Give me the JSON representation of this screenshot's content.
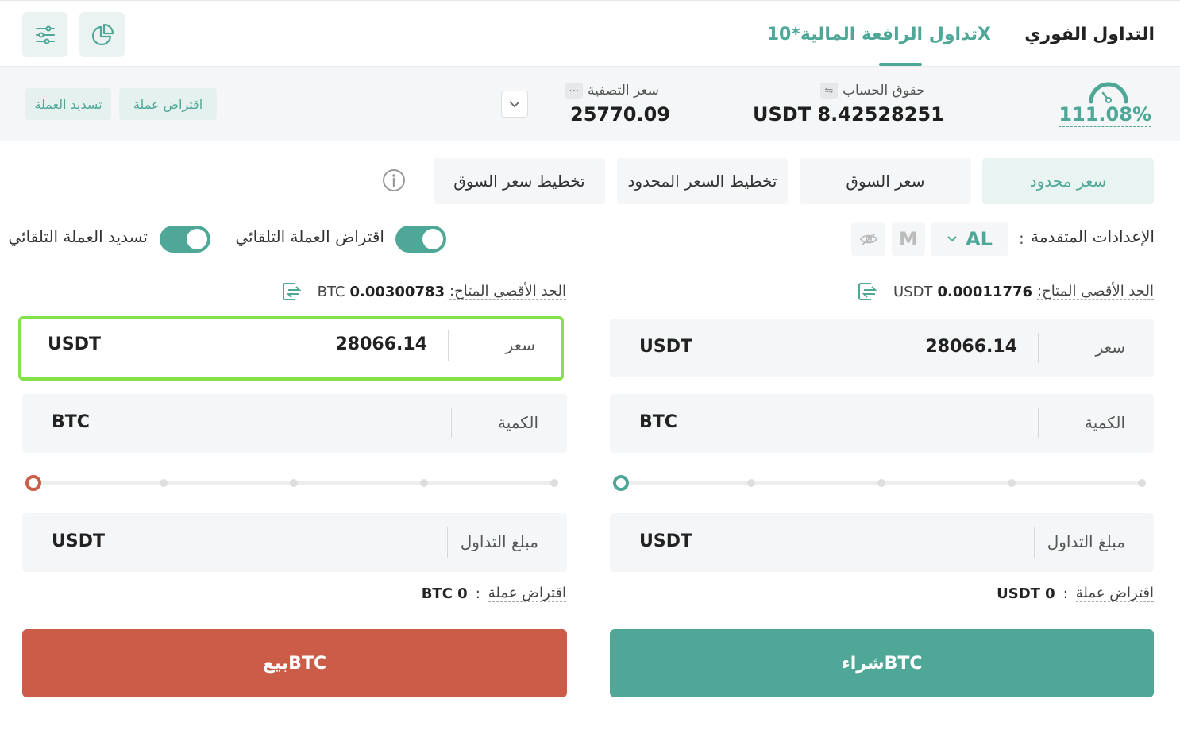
{
  "header": {
    "tab_spot": "التداول الفوري",
    "tab_margin": "تداول الرافعة المالية*10X",
    "filter_icon": "sliders-icon",
    "chart_icon": "pie-chart-icon"
  },
  "account": {
    "risk_ratio": "111.08%",
    "equity_label": "حقوق الحساب",
    "equity_value": "USDT 8.42528251",
    "liq_label": "سعر التصفية",
    "liq_value": "25770.09",
    "borrow_btn": "اقتراض عملة",
    "repay_btn": "تسديد العملة"
  },
  "order_tabs": {
    "limit": "سعر محدود",
    "market": "سعر السوق",
    "plan_limit": "تخطيط السعر المحدود",
    "plan_market": "تخطيط سعر السوق"
  },
  "settings": {
    "advanced_label": "الإعدادات المتقدمة",
    "colon": ":",
    "al": "AL",
    "m": "M",
    "auto_borrow": "اقتراض العملة التلقائي",
    "auto_repay": "تسديد العملة التلقائي"
  },
  "buy": {
    "avail_label": "الحد الأقصى المتاح:",
    "avail_value": "0.00011776",
    "avail_currency": "USDT",
    "price_label": "سعر",
    "price_value": "28066.14",
    "price_unit": "USDT",
    "qty_label": "الكمية",
    "qty_unit": "BTC",
    "amount_label": "مبلغ التداول",
    "amount_unit": "USDT",
    "borrow_label": "اقتراض عملة",
    "borrow_sep": ":",
    "borrow_value": "USDT 0",
    "button": "شراءBTC",
    "color": "#4fa897"
  },
  "sell": {
    "avail_label": "الحد الأقصى المتاح:",
    "avail_value": "0.00300783",
    "avail_currency": "BTC",
    "price_label": "سعر",
    "price_value": "28066.14",
    "price_unit": "USDT",
    "qty_label": "الكمية",
    "qty_unit": "BTC",
    "amount_label": "مبلغ التداول",
    "amount_unit": "USDT",
    "borrow_label": "اقتراض عملة",
    "borrow_sep": ":",
    "borrow_value": "BTC 0",
    "button": "بيعBTC",
    "color": "#cb5c48"
  }
}
